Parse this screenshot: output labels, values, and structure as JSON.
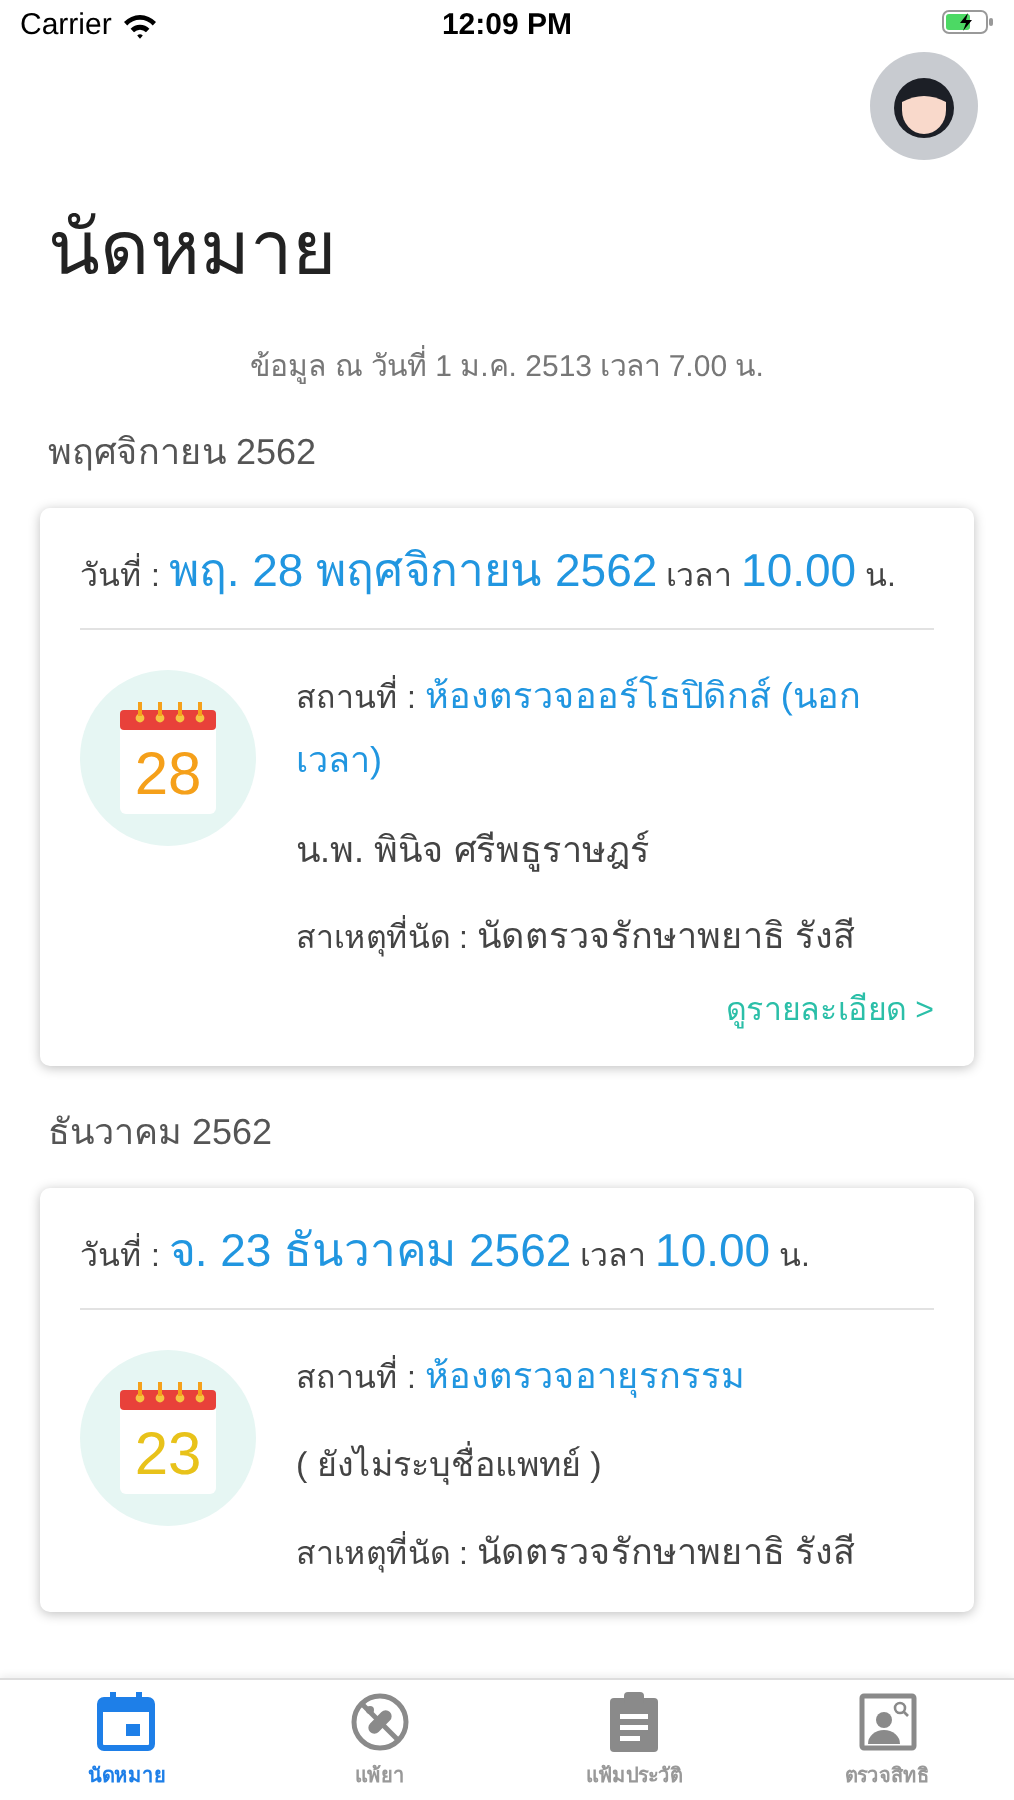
{
  "status_bar": {
    "carrier": "Carrier",
    "time": "12:09 PM"
  },
  "title": "นัดหมาย",
  "info": "ข้อมูล ณ วันที่ 1 ม.ค. 2513 เวลา 7.00 น.",
  "sections": [
    {
      "month": "พฤศจิกายน 2562",
      "appointments": [
        {
          "date_label": "วันที่ :",
          "date": "พฤ. 28 พฤศจิกายน 2562",
          "time_label": "เวลา",
          "time": "10.00",
          "time_unit": "น.",
          "day": "28",
          "color": "#f5a01a",
          "place_label": "สถานที่ :",
          "place": "ห้องตรวจออร์โธปิดิกส์ (นอกเวลา)",
          "doctor": "น.พ. พินิจ ศรีพธูราษฎร์",
          "doctor_assigned": true,
          "reason_label": "สาเหตุที่นัด :",
          "reason": "นัดตรวจรักษาพยาธิ รังสี",
          "detail_link": "ดูรายละเอียด >"
        }
      ]
    },
    {
      "month": "ธันวาคม 2562",
      "appointments": [
        {
          "date_label": "วันที่ :",
          "date": "จ. 23 ธันวาคม 2562",
          "time_label": "เวลา",
          "time": "10.00",
          "time_unit": "น.",
          "day": "23",
          "color": "#e8c21a",
          "place_label": "สถานที่ :",
          "place": "ห้องตรวจอายุรกรรม",
          "doctor": "( ยังไม่ระบุชื่อแพทย์ )",
          "doctor_assigned": false,
          "reason_label": "สาเหตุที่นัด :",
          "reason": "นัดตรวจรักษาพยาธิ รังสี"
        }
      ]
    }
  ],
  "tabs": [
    {
      "kind": "calendar",
      "label": "นัดหมาย",
      "selected": true
    },
    {
      "kind": "pills",
      "label": "แพ้ยา",
      "selected": false
    },
    {
      "kind": "clipboard",
      "label": "แฟ้มประวัติ",
      "selected": false
    },
    {
      "kind": "profile",
      "label": "ตรวจสิทธิ",
      "selected": false
    }
  ]
}
